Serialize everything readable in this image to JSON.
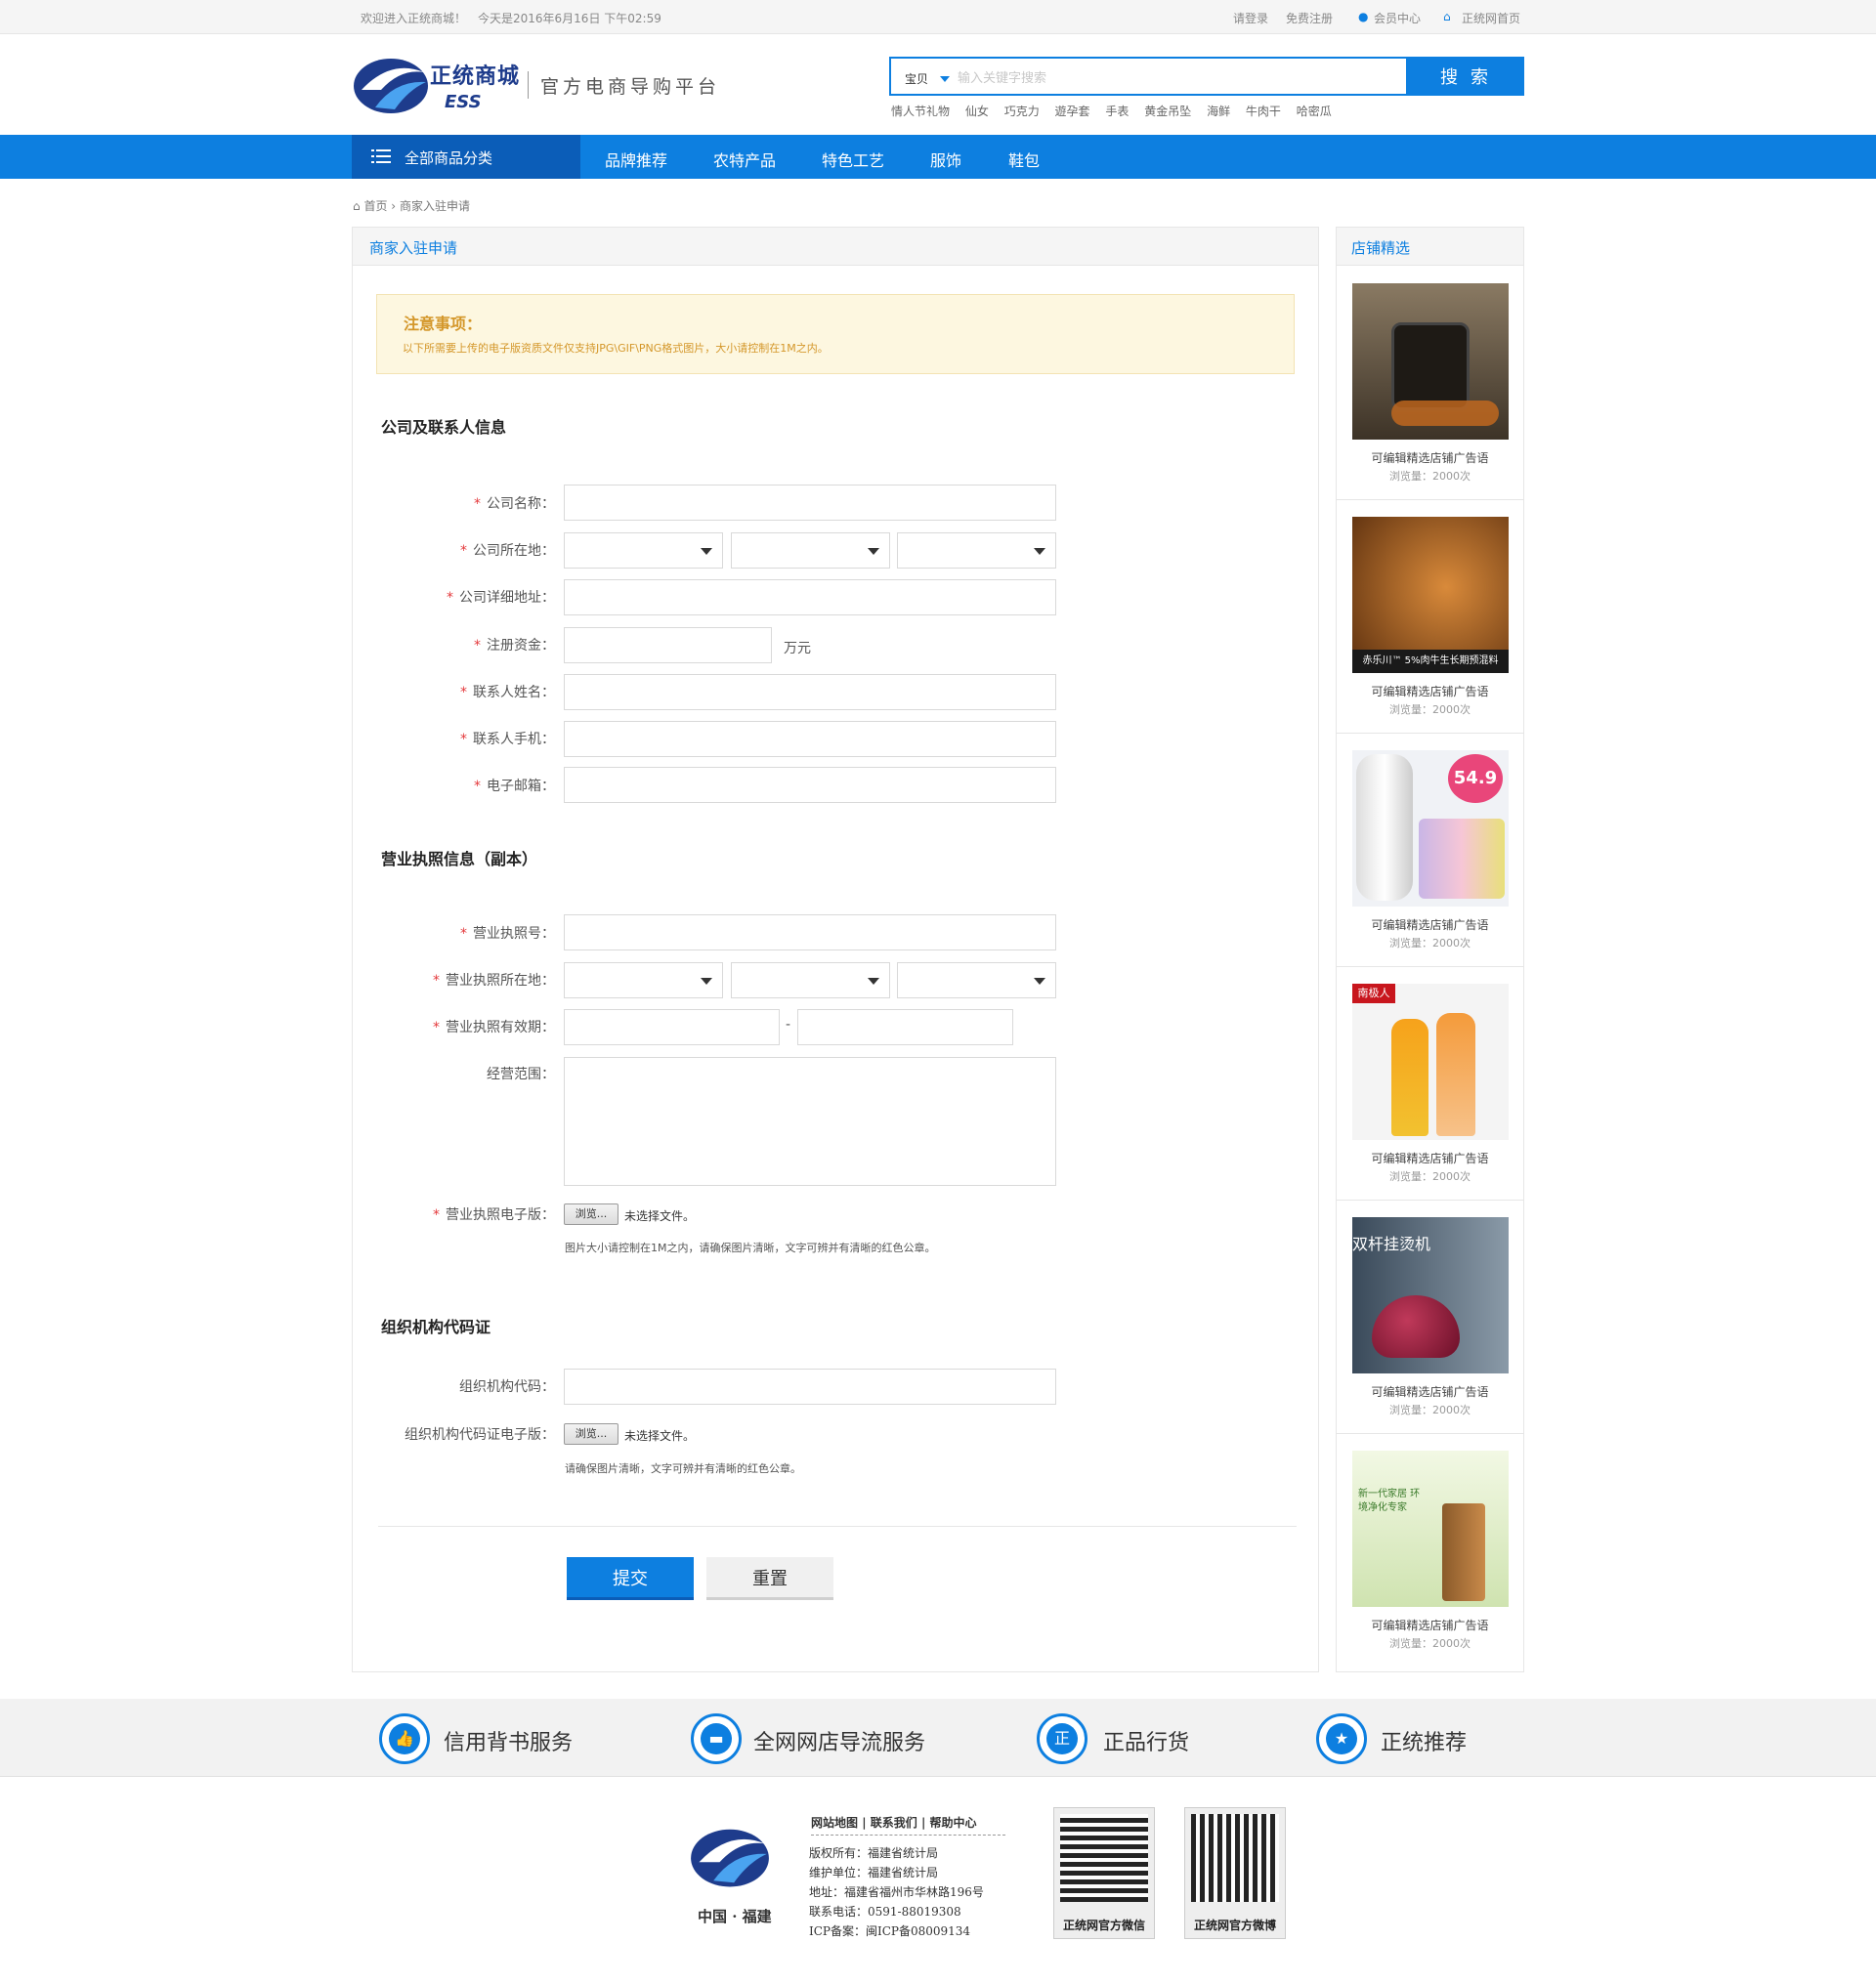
{
  "topbar": {
    "welcome": "欢迎进入正统商城！",
    "date": "今天是2016年6月16日 下午02:59",
    "login": "请登录",
    "register": "免费注册",
    "member": "会员中心",
    "home": "正统网首页"
  },
  "header": {
    "logo_cn": "正统商城",
    "logo_en": "ESS",
    "slogan": "官方电商导购平台",
    "search_type": "宝贝",
    "search_placeholder": "输入关键字搜索",
    "search_button": "搜 索",
    "hot_words": [
      "情人节礼物",
      "仙女",
      "巧克力",
      "遊孕套",
      "手表",
      "黄金吊坠",
      "海鲜",
      "牛肉干",
      "哈密瓜"
    ]
  },
  "nav": {
    "all_categories": "全部商品分类",
    "items": [
      "品牌推荐",
      "农特产品",
      "特色工艺",
      "服饰",
      "鞋包"
    ]
  },
  "breadcrumb": {
    "home": "首页",
    "current": "商家入驻申请"
  },
  "main": {
    "title": "商家入驻申请",
    "notice_title": "注意事项：",
    "notice_text": "以下所需要上传的电子版资质文件仅支持JPG\\GIF\\PNG格式图片，大小请控制在1M之内。",
    "section1": "公司及联系人信息",
    "section2": "营业执照信息（副本）",
    "section3": "组织机构代码证",
    "labels": {
      "company_name": "公司名称：",
      "company_location": "公司所在地：",
      "company_address": "公司详细地址：",
      "capital": "注册资金：",
      "contact_name": "联系人姓名：",
      "contact_phone": "联系人手机：",
      "email": "电子邮箱：",
      "license_no": "营业执照号：",
      "license_location": "营业执照所在地：",
      "license_valid": "营业执照有效期：",
      "business_scope": "经营范围：",
      "license_file": "营业执照电子版：",
      "org_code": "组织机构代码：",
      "org_code_file": "组织机构代码证电子版："
    },
    "capital_unit": "万元",
    "date_separator": "-",
    "browse": "浏览...",
    "no_file": "未选择文件。",
    "license_hint": "图片大小请控制在1M之内，请确保图片清晰，文字可辨并有清晰的红色公章。",
    "org_hint": "请确保图片清晰，文字可辨并有清晰的红色公章。",
    "submit": "提交",
    "reset": "重置"
  },
  "side": {
    "title": "店铺精选",
    "shops": [
      {
        "name": "可编辑精选店铺广告语",
        "views": "浏览量：2000次",
        "badge": ""
      },
      {
        "name": "可编辑精选店铺广告语",
        "views": "浏览量：2000次",
        "badge": "赤乐川™ 5%肉牛生长期预混料"
      },
      {
        "name": "可编辑精选店铺广告语",
        "views": "浏览量：2000次",
        "badge": "54.9"
      },
      {
        "name": "可编辑精选店铺广告语",
        "views": "浏览量：2000次",
        "badge": "南极人"
      },
      {
        "name": "可编辑精选店铺广告语",
        "views": "浏览量：2000次",
        "badge": "双杆挂烫机"
      },
      {
        "name": "可编辑精选店铺广告语",
        "views": "浏览量：2000次",
        "badge": "新一代家居 环境净化专家"
      }
    ]
  },
  "services": [
    {
      "label": "信用背书服务",
      "icon": "thumbs-up-icon",
      "glyph": "👍"
    },
    {
      "label": "全网网店导流服务",
      "icon": "ticket-icon",
      "glyph": "▬"
    },
    {
      "label": "正品行货",
      "icon": "shield-icon",
      "glyph": "正"
    },
    {
      "label": "正统推荐",
      "icon": "star-icon",
      "glyph": "★"
    }
  ],
  "footer": {
    "logo_caption": "中国 · 福建",
    "links": [
      "网站地图",
      "联系我们",
      "帮助中心"
    ],
    "lines": [
      "版权所有：福建省统计局",
      "维护单位：福建省统计局",
      "地址：福建省福州市华林路196号",
      "联系电话：0591-88019308",
      "ICP备案：闽ICP备08009134"
    ],
    "qr1": "正统网官方微信",
    "qr2": "正统网官方微博"
  },
  "colors": {
    "accent": "#0d7fe0",
    "accent_dark": "#0b5db8",
    "required": "#e4393c",
    "notice": "#d4972a"
  }
}
